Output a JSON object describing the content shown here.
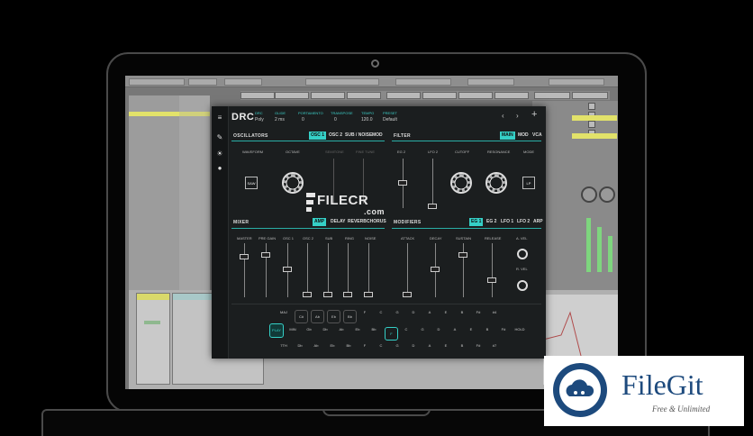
{
  "plugin": {
    "logo": "DRC",
    "header": {
      "fields": [
        {
          "label": "DRC",
          "value": "Poly"
        },
        {
          "label": "GLIDE",
          "value": "2 ms"
        },
        {
          "label": "PORTAMENTO",
          "value": "0"
        },
        {
          "label": "TRANSPOSE",
          "value": "0"
        },
        {
          "label": "TEMPO",
          "value": "120.0"
        },
        {
          "label": "PRESET",
          "value": "Default"
        }
      ],
      "nav_prev": "‹",
      "nav_next": "›",
      "add": "+"
    },
    "oscillators": {
      "title": "OSCILLATORS",
      "tabs": [
        "OSC 1",
        "OSC 2",
        "SUB / NOISE",
        "MOD"
      ],
      "params": [
        "WAVEFORM",
        "OCTAVE",
        "SEMITONE",
        "FINE TUNE"
      ],
      "wave_button": "SAW"
    },
    "filter": {
      "title": "FILTER",
      "tabs": [
        "MAIN",
        "MOD",
        "VCA"
      ],
      "params": [
        "EG 2",
        "LFO 2",
        "CUTOFF",
        "RESONANCE",
        "MODE"
      ],
      "mode_button": "LP"
    },
    "mixer": {
      "title": "MIXER",
      "tabs": [
        "AMP",
        "DELAY",
        "REVERB",
        "CHORUS"
      ],
      "channels": [
        "MASTER",
        "PRE GAIN",
        "OSC 1",
        "OSC 2",
        "SUB",
        "RING",
        "NOISE"
      ]
    },
    "modifiers": {
      "title": "MODIFIERS",
      "tabs": [
        "EG 1",
        "EG 2",
        "LFO 1",
        "LFO 2",
        "ARP"
      ],
      "params": [
        "ATTACK",
        "DECAY",
        "SUSTAIN",
        "RELEASE",
        "A. VEL",
        "R. VEL"
      ]
    },
    "keyboard": {
      "row1": [
        "MAJ",
        "C#",
        "Ab",
        "Eb",
        "Bb",
        "F",
        "C",
        "G",
        "D",
        "A",
        "E",
        "B",
        "F#",
        "#4"
      ],
      "row2": [
        "MIN",
        "Gb",
        "Db",
        "Ab",
        "Eb",
        "Bb",
        "F",
        "C",
        "G",
        "D",
        "A",
        "E",
        "B",
        "F#",
        "HOLD"
      ],
      "row3": [
        "7TH",
        "Db",
        "Ab",
        "Eb",
        "Bb",
        "F",
        "C",
        "G",
        "D",
        "A",
        "E",
        "B",
        "F#",
        "#7"
      ],
      "play": "PLAY"
    }
  },
  "watermarks": {
    "filecr_name": "FILECR",
    "filecr_ext": ".com",
    "filegit_title": "FileGit",
    "filegit_sub": "Free & Unlimited"
  },
  "colors": {
    "accent": "#35d0c7",
    "panel": "#1b1e1f",
    "filegit_blue": "#1d4a7d"
  }
}
